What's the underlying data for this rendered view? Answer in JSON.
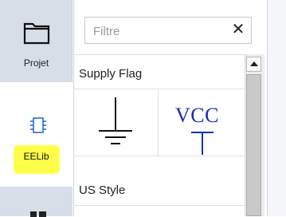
{
  "nav": {
    "tabs": [
      {
        "label": "Projet",
        "icon": "folder-icon"
      },
      {
        "label": "EELib",
        "icon": "chip-icon",
        "highlight": "#ffff4a"
      },
      {
        "label": "",
        "icon": "toolbox-icon"
      }
    ]
  },
  "search": {
    "placeholder": "Filtre",
    "value": "",
    "clear_label": "✕"
  },
  "sections": [
    {
      "title": "Supply Flag",
      "symbols": [
        {
          "name": "ground-symbol"
        },
        {
          "name": "vcc-symbol",
          "text": "VCC",
          "color": "#1a2fb5"
        }
      ]
    },
    {
      "title": "US Style"
    }
  ]
}
